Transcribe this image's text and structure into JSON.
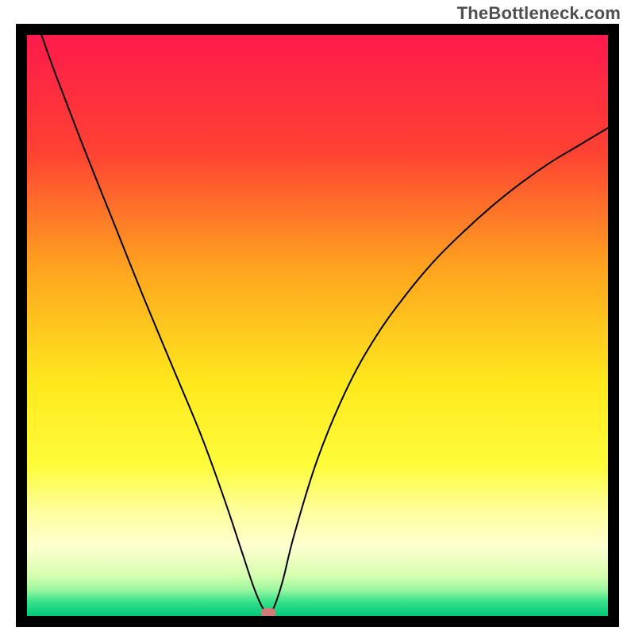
{
  "watermark": {
    "text": "TheBottleneck.com"
  },
  "chart_data": {
    "type": "line",
    "title": "",
    "xlabel": "",
    "ylabel": "",
    "xlim": [
      0,
      100
    ],
    "ylim": [
      0,
      100
    ],
    "gradient_stops": [
      {
        "offset": 0.0,
        "color": "#ff1a4b"
      },
      {
        "offset": 0.2,
        "color": "#ff4133"
      },
      {
        "offset": 0.4,
        "color": "#ffa31f"
      },
      {
        "offset": 0.6,
        "color": "#ffe91d"
      },
      {
        "offset": 0.74,
        "color": "#fffc3a"
      },
      {
        "offset": 0.82,
        "color": "#ffff9d"
      },
      {
        "offset": 0.88,
        "color": "#ffffd0"
      },
      {
        "offset": 0.93,
        "color": "#d6ffb0"
      },
      {
        "offset": 0.955,
        "color": "#9cf7a0"
      },
      {
        "offset": 0.975,
        "color": "#38e28a"
      },
      {
        "offset": 1.0,
        "color": "#00c97a"
      }
    ],
    "series": [
      {
        "name": "bottleneck-curve",
        "x": [
          2.5,
          5,
          10,
          15,
          20,
          25,
          30,
          34,
          37,
          39,
          40.5,
          41.5,
          42.5,
          44,
          46,
          50,
          55,
          60,
          65,
          70,
          75,
          80,
          85,
          90,
          95,
          100
        ],
        "y": [
          100,
          93,
          80,
          67.5,
          55,
          43,
          31,
          20,
          11,
          5,
          1.5,
          0.5,
          1.5,
          6,
          14,
          27,
          39,
          48,
          55,
          61,
          66,
          70.5,
          74.5,
          78,
          81,
          84
        ]
      }
    ],
    "marker": {
      "x": 41.5,
      "y": 0.5,
      "color": "#cd7d76"
    }
  }
}
